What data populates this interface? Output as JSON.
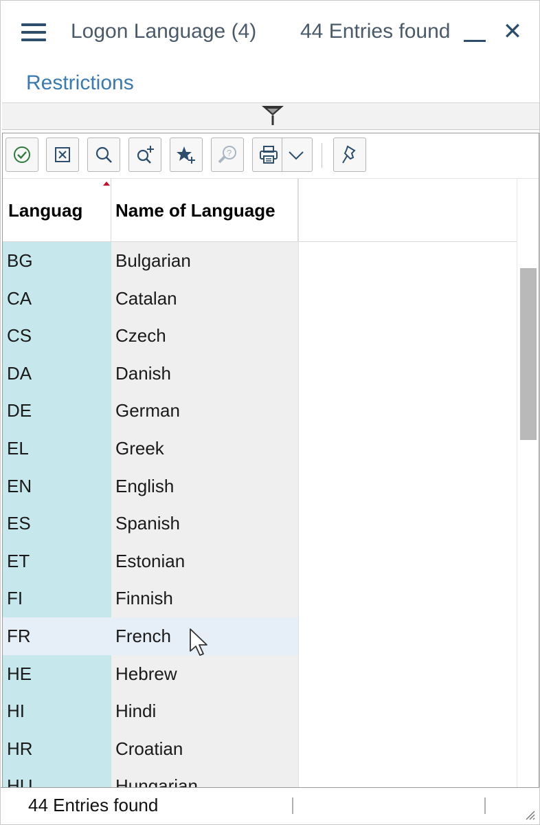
{
  "header": {
    "title": "Logon Language (4)",
    "entries_count": "44 Entries found",
    "menu_icon": "hamburger-menu-icon",
    "minimize_icon": "minimize-icon",
    "close_icon": "close-icon",
    "close_glyph": "✕"
  },
  "restrictions": {
    "label": "Restrictions"
  },
  "toolbar": {
    "buttons": [
      {
        "icon": "checkmark-icon"
      },
      {
        "icon": "cancel-icon"
      },
      {
        "icon": "search-icon"
      },
      {
        "icon": "search-plus-icon"
      },
      {
        "icon": "favorite-add-icon"
      },
      {
        "icon": "help-icon"
      },
      {
        "icon": "print-icon"
      },
      {
        "icon": "chevron-down-icon"
      },
      {
        "icon": "pin-icon"
      }
    ]
  },
  "table": {
    "columns": [
      {
        "label": "Languag",
        "ellipsis": "..."
      },
      {
        "label": "Name of Language"
      }
    ],
    "rows": [
      {
        "code": "BG",
        "name": "Bulgarian"
      },
      {
        "code": "CA",
        "name": "Catalan"
      },
      {
        "code": "CS",
        "name": "Czech"
      },
      {
        "code": "DA",
        "name": "Danish"
      },
      {
        "code": "DE",
        "name": "German"
      },
      {
        "code": "EL",
        "name": "Greek"
      },
      {
        "code": "EN",
        "name": "English"
      },
      {
        "code": "ES",
        "name": "Spanish"
      },
      {
        "code": "ET",
        "name": "Estonian"
      },
      {
        "code": "FI",
        "name": "Finnish"
      },
      {
        "code": "FR",
        "name": "French"
      },
      {
        "code": "HE",
        "name": "Hebrew"
      },
      {
        "code": "HI",
        "name": "Hindi"
      },
      {
        "code": "HR",
        "name": "Croatian"
      },
      {
        "code": "HU",
        "name": "Hungarian"
      }
    ],
    "hover_row_index": 10
  },
  "colors": {
    "code_column": "#c6e8ec",
    "name_column": "#efefef",
    "hover_row": "#e6eef7",
    "accent_link": "#3a7ab0",
    "sort_indicator": "#c8102e"
  },
  "status": {
    "text": "44 Entries found"
  }
}
